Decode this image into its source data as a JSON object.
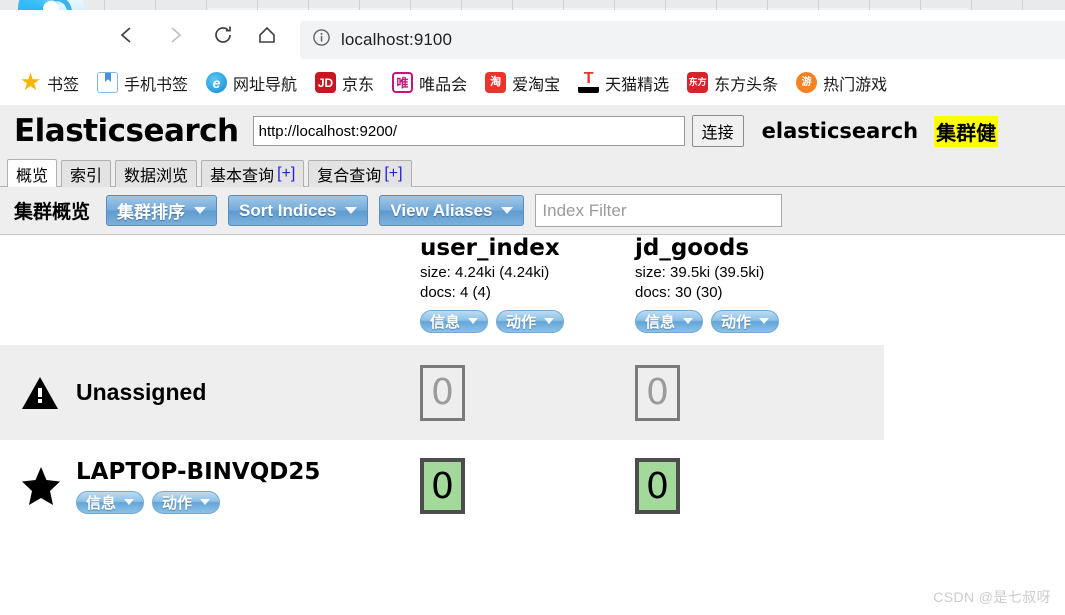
{
  "browser": {
    "back_icon": "chevron-left-icon",
    "forward_icon": "chevron-right-icon",
    "reload_icon": "reload-icon",
    "home_icon": "home-icon",
    "info_icon": "info-circle-icon",
    "url": "localhost:9100",
    "bookmarks": [
      {
        "label": "书签",
        "icon": "star-icon",
        "ico_class": "ico-star",
        "glyph": "★"
      },
      {
        "label": "手机书签",
        "icon": "phone-bookmark-icon",
        "ico_class": "ico-phone",
        "glyph": ""
      },
      {
        "label": "网址导航",
        "icon": "navigation-icon",
        "ico_class": "ico-nav",
        "glyph": ""
      },
      {
        "label": "京东",
        "icon": "jd-icon",
        "ico_class": "ico-jd",
        "glyph": "JD"
      },
      {
        "label": "唯品会",
        "icon": "vip-icon",
        "ico_class": "ico-vip",
        "glyph": "唯"
      },
      {
        "label": "爱淘宝",
        "icon": "taobao-icon",
        "ico_class": "ico-tao",
        "glyph": "淘"
      },
      {
        "label": "天猫精选",
        "icon": "tmall-icon",
        "ico_class": "ico-tmall",
        "glyph": ""
      },
      {
        "label": "东方头条",
        "icon": "dongfang-icon",
        "ico_class": "ico-dongfang",
        "glyph": "东方"
      },
      {
        "label": "热门游戏",
        "icon": "game-icon",
        "ico_class": "ico-game",
        "glyph": "游"
      }
    ]
  },
  "es": {
    "title": "Elasticsearch",
    "cluster_url_value": "http://localhost:9200/",
    "connect_label": "连接",
    "cluster_name": "elasticsearch",
    "health_label": "集群健",
    "health_bg": "#ffff00",
    "tabs": [
      {
        "label": "概览",
        "plus": "",
        "active": true
      },
      {
        "label": "索引",
        "plus": "",
        "active": false
      },
      {
        "label": "数据浏览",
        "plus": "",
        "active": false
      },
      {
        "label": "基本查询",
        "plus": "[+]",
        "active": false
      },
      {
        "label": "复合查询",
        "plus": "[+]",
        "active": false
      }
    ],
    "toolbar": {
      "title": "集群概览",
      "sort_cluster_label": "集群排序",
      "sort_indices_label": "Sort Indices",
      "view_aliases_label": "View Aliases",
      "index_filter_placeholder": "Index Filter",
      "index_filter_value": ""
    },
    "indices": [
      {
        "name": "user_index",
        "size": "size: 4.24ki (4.24ki)",
        "docs": "docs: 4 (4)",
        "info_label": "信息",
        "action_label": "动作"
      },
      {
        "name": "jd_goods",
        "size": "size: 39.5ki (39.5ki)",
        "docs": "docs: 30 (30)",
        "info_label": "信息",
        "action_label": "动作"
      }
    ],
    "rows": [
      {
        "label": "Unassigned",
        "icon": "warning-triangle-icon",
        "shards": [
          "0",
          "0"
        ],
        "shard_state": "empty"
      },
      {
        "label": "LAPTOP-BINVQD25",
        "icon": "star-icon",
        "info_label": "信息",
        "action_label": "动作",
        "shards": [
          "0",
          "0"
        ],
        "shard_state": "assigned",
        "shard_bg": "#a3d99a"
      }
    ]
  },
  "watermark": "CSDN @是七叔呀"
}
